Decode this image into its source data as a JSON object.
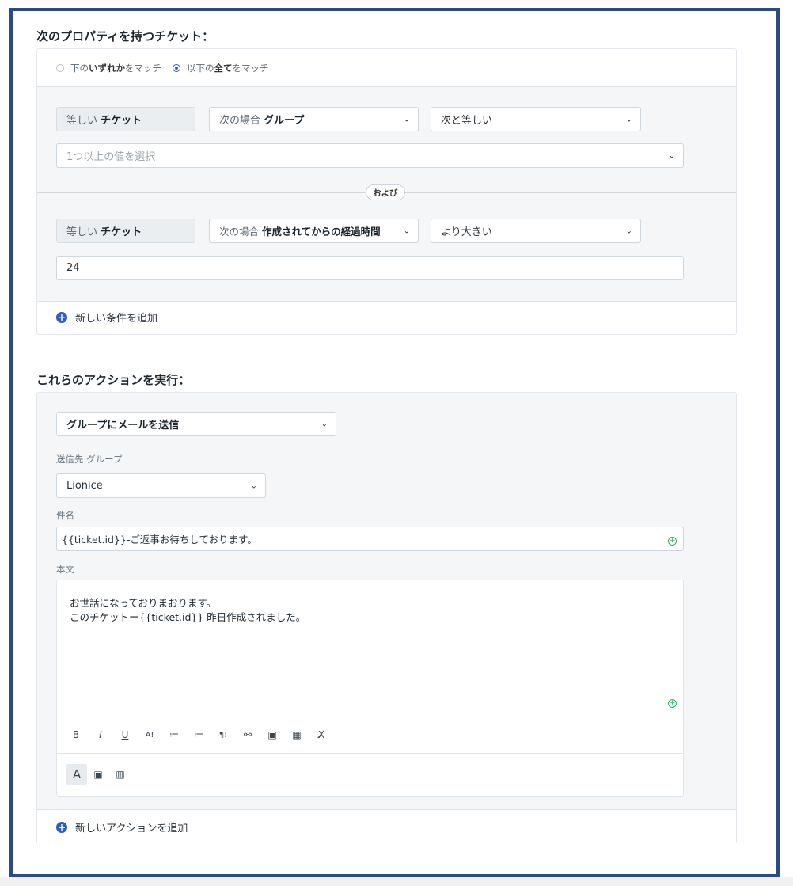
{
  "conditions": {
    "heading": "次のプロパティを持つチケット：",
    "match_any": {
      "prefix": "下の",
      "bold": "いずれか",
      "suffix": "をマッチ"
    },
    "match_all": {
      "prefix": "以下の",
      "bold": "全て",
      "suffix": "をマッチ"
    },
    "rows": [
      {
        "scope_prefix": "等しい",
        "scope_bold": "チケット",
        "field_prefix": "次の場合",
        "field_bold": "グループ",
        "operator": "次と等しい",
        "value_placeholder": "1つ以上の値を選択"
      },
      {
        "scope_prefix": "等しい",
        "scope_bold": "チケット",
        "field_prefix": "次の場合",
        "field_bold": "作成されてからの経過時間",
        "operator": "より大きい",
        "value": "24"
      }
    ],
    "and_label": "および",
    "add_condition": "新しい条件を追加"
  },
  "actions": {
    "heading": "これらのアクションを実行：",
    "action_type": "グループにメールを送信",
    "send_to_label": "送信先 グループ",
    "send_to_value": "Lionice",
    "subject_label": "件名",
    "subject_value": "{{ticket.id}}-ご返事お待ちしております。",
    "body_label": "本文",
    "body_line1": "お世話になっておりまおります。",
    "body_line2": "このチケットー{{ticket.id}} 昨日作成されました。",
    "toolbar": [
      "B",
      "I",
      "U",
      "A!",
      "≔",
      "≔",
      "¶!",
      "⚯",
      "▣",
      "▦",
      "X̸"
    ],
    "toolbar2": [
      "A",
      "▣",
      "▥"
    ],
    "add_action": "新しいアクションを追加"
  },
  "colors": {
    "frame": "#2d4a86",
    "accent": "#2c5cc5",
    "green": "#2fae67"
  }
}
